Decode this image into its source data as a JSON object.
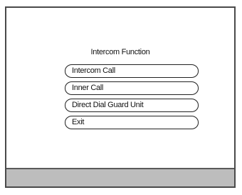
{
  "screen": {
    "title": "Intercom Function",
    "menu_items": [
      {
        "label": "Intercom Call"
      },
      {
        "label": "Inner Call"
      },
      {
        "label": "Direct Dial Guard Unit"
      },
      {
        "label": "Exit"
      }
    ]
  },
  "colors": {
    "frame_border": "#4a4a4a",
    "status_bar": "#bdbdbd",
    "text": "#111111"
  }
}
